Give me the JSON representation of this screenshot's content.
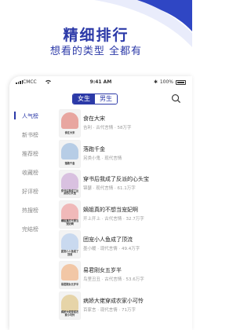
{
  "hero": {
    "title": "精细排行",
    "subtitle": "想看的类型 全都有"
  },
  "status_bar": {
    "carrier": "CMCC",
    "time": "9:41 AM",
    "battery": "100%"
  },
  "gender_tabs": [
    {
      "label": "女生",
      "active": true
    },
    {
      "label": "男生",
      "active": false
    }
  ],
  "sidebar": {
    "items": [
      {
        "label": "人气榜",
        "active": true
      },
      {
        "label": "新书榜",
        "active": false
      },
      {
        "label": "推荐榜",
        "active": false
      },
      {
        "label": "收藏榜",
        "active": false
      },
      {
        "label": "好评榜",
        "active": false
      },
      {
        "label": "热搜榜",
        "active": false
      },
      {
        "label": "完结榜",
        "active": false
      }
    ]
  },
  "books": [
    {
      "title": "食在大宋",
      "meta": "吉利 · 古代言情 · 58万字",
      "cover_text": "食在大宋",
      "cover_color": "#e8a6a0"
    },
    {
      "title": "落跑千金",
      "meta": "另类小鬼 · 现代言情",
      "cover_text": "落跑千金",
      "cover_color": "#b7cde6"
    },
    {
      "title": "穿书后我成了反派的心头宝",
      "meta": "锦瑟 · 现代言情 · 61.1万字",
      "cover_text": "穿书后我成了反派的心头宝",
      "cover_color": "#d9c1e0"
    },
    {
      "title": "嫡姐真的不想当宠妃啊",
      "meta": "开上开上 · 古代言情 · 32.7万字",
      "cover_text": "嫡姐真的不想当宠妃啊",
      "cover_color": "#f0b9b9"
    },
    {
      "title": "团宠小人鱼成了顶流",
      "meta": "墨小暖 · 现代言情 · 49.4万字",
      "cover_text": "团宠小人鱼成了顶流",
      "cover_color": "#c9d9ef"
    },
    {
      "title": "易君刚女五岁半",
      "meta": "鸟里丑丑 · 古代言情 · 53.6万字",
      "cover_text": "易君刚女五岁半",
      "cover_color": "#f2c7a6"
    },
    {
      "title": "病娇大佬穿成农家小可怜",
      "meta": "百家言 · 现代言情 · 71万字",
      "cover_text": "病娇大佬穿成农家小可怜",
      "cover_color": "#e6d4a8"
    }
  ],
  "colors": {
    "accent": "#2c3aa8",
    "wave": "#2f46c4"
  },
  "icons": {
    "search": "search-icon"
  }
}
